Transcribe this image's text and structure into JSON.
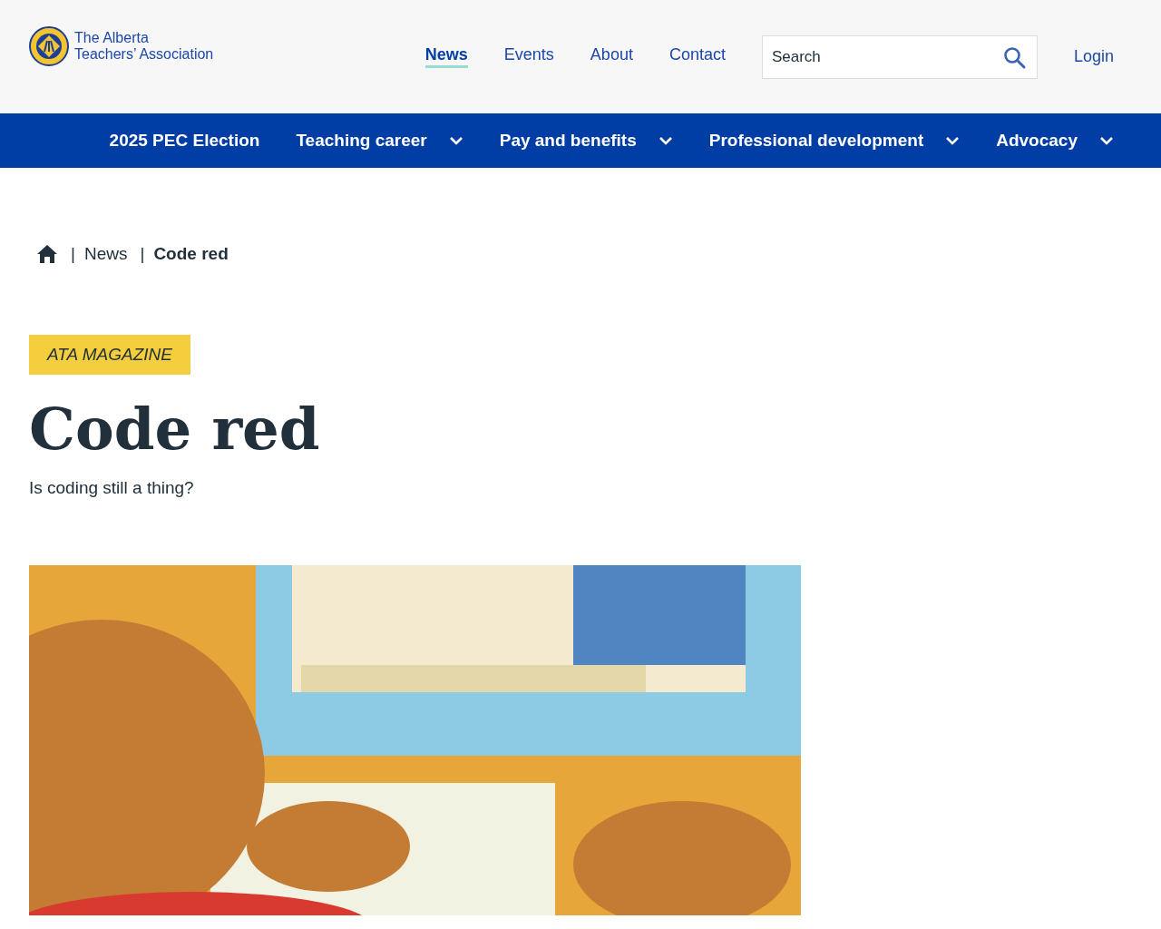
{
  "logo": {
    "line1": "The Alberta",
    "line2": "Teachers’ Association"
  },
  "top_nav": [
    {
      "label": "News",
      "selected": true
    },
    {
      "label": "Events",
      "selected": false
    },
    {
      "label": "About",
      "selected": false
    },
    {
      "label": "Contact",
      "selected": false
    }
  ],
  "search": {
    "placeholder": "Search"
  },
  "login": "Login",
  "main_nav": [
    {
      "label": "2025 PEC Election",
      "has_menu": false
    },
    {
      "label": "Teaching career",
      "has_menu": true
    },
    {
      "label": "Pay and benefits",
      "has_menu": true
    },
    {
      "label": "Professional development",
      "has_menu": true
    },
    {
      "label": "Advocacy",
      "has_menu": true
    }
  ],
  "breadcrumb": [
    {
      "separator": "|",
      "label": "News",
      "current": false
    },
    {
      "separator": "|",
      "label": "Code red",
      "current": true
    }
  ],
  "category": "ATA MAGAZINE",
  "title": "Code red",
  "subtitle": "Is coding still a thing?"
}
